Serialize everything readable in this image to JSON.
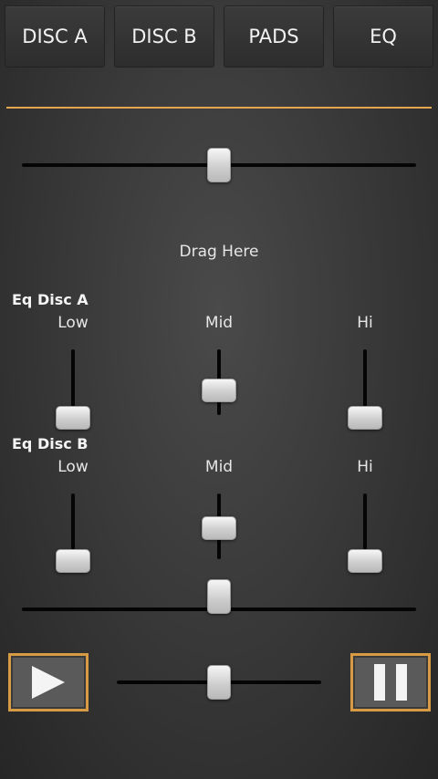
{
  "tabs": [
    {
      "label": "DISC A"
    },
    {
      "label": "DISC B"
    },
    {
      "label": "PADS"
    },
    {
      "label": "EQ"
    }
  ],
  "crossfader": {
    "value": 0.5
  },
  "drag_label": "Drag Here",
  "eq_a": {
    "title": "Eq Disc A",
    "bands": [
      {
        "label": "Low",
        "value": 0.0
      },
      {
        "label": "Mid",
        "value": 0.5
      },
      {
        "label": "Hi",
        "value": 0.0
      }
    ]
  },
  "eq_b": {
    "title": "Eq Disc B",
    "bands": [
      {
        "label": "Low",
        "value": 0.0
      },
      {
        "label": "Mid",
        "value": 0.6
      },
      {
        "label": "Hi",
        "value": 0.0
      }
    ]
  },
  "lower_fader": {
    "value": 0.5
  },
  "transport": {
    "play_icon": "play-icon",
    "pause_icon": "pause-icon",
    "speed_value": 0.5
  },
  "colors": {
    "accent": "#e3a64f",
    "button_border": "#d79a45"
  }
}
